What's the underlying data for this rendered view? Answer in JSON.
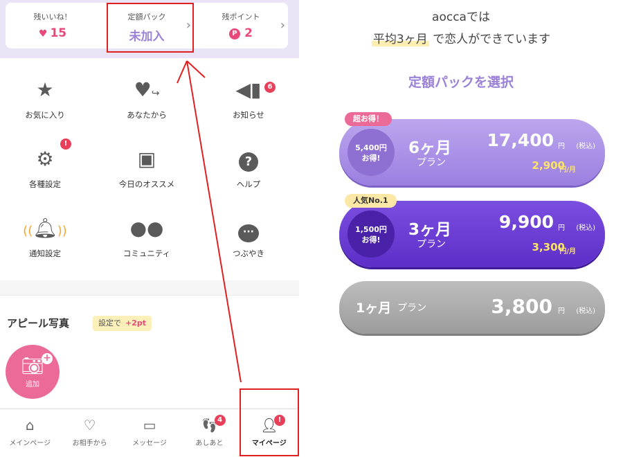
{
  "stats": {
    "likes_label": "残いいね！",
    "likes_value": "15",
    "pack_label": "定額パック",
    "pack_value": "未加入",
    "points_label": "残ポイント",
    "points_value": "2",
    "points_badge": "P"
  },
  "menu": [
    {
      "label": "お気に入り",
      "icon": "star-icon"
    },
    {
      "label": "あなたから",
      "icon": "heart-arrow-icon"
    },
    {
      "label": "お知らせ",
      "icon": "megaphone-icon",
      "badge": "6"
    },
    {
      "label": "各種設定",
      "icon": "gear-icon",
      "badge": "!"
    },
    {
      "label": "今日のオススメ",
      "icon": "photo-stack-icon"
    },
    {
      "label": "ヘルプ",
      "icon": "help-icon"
    },
    {
      "label": "通知設定",
      "icon": "bell-icon"
    },
    {
      "label": "コミュニティ",
      "icon": "group-icon"
    },
    {
      "label": "つぶやき",
      "icon": "speech-bubble-icon"
    }
  ],
  "appeal": {
    "title": "アピール写真",
    "badge_text": "設定で",
    "badge_bonus": "+2pt",
    "add_label": "追加"
  },
  "tabs": [
    {
      "label": "メインページ",
      "icon": "home-icon"
    },
    {
      "label": "お相手から",
      "icon": "heart-outline-icon"
    },
    {
      "label": "メッセージ",
      "icon": "message-icon"
    },
    {
      "label": "あしあと",
      "icon": "footprints-icon",
      "badge": "4"
    },
    {
      "label": "マイページ",
      "icon": "person-icon",
      "badge": "!",
      "active": true
    }
  ],
  "promo": {
    "headline_prefix": "aoccaでは",
    "headline_highlight": "平均3ヶ月",
    "headline_suffix": "で恋人ができています",
    "choose_title": "定額パックを選択"
  },
  "plans": {
    "six": {
      "ribbon": "超お得！",
      "discount": "5,400円",
      "discount_sub": "お得!",
      "months": "6ヶ月",
      "plan_word": "プラン",
      "price": "17,400",
      "yen": "円",
      "tax": "(税込)",
      "monthly": "2,900",
      "monthly_unit": "円/月"
    },
    "three": {
      "ribbon": "人気No.1",
      "discount": "1,500円",
      "discount_sub": "お得!",
      "months": "3ヶ月",
      "plan_word": "プラン",
      "price": "9,900",
      "yen": "円",
      "tax": "(税込)",
      "monthly": "3,300",
      "monthly_unit": "円/月"
    },
    "one": {
      "months": "1ヶ月",
      "plan_word": "プラン",
      "price": "3,800",
      "yen": "円",
      "tax": "(税込)"
    }
  },
  "colors": {
    "accent_purple": "#9b82d6",
    "pink": "#e8497b",
    "annotation_red": "#e02020"
  }
}
